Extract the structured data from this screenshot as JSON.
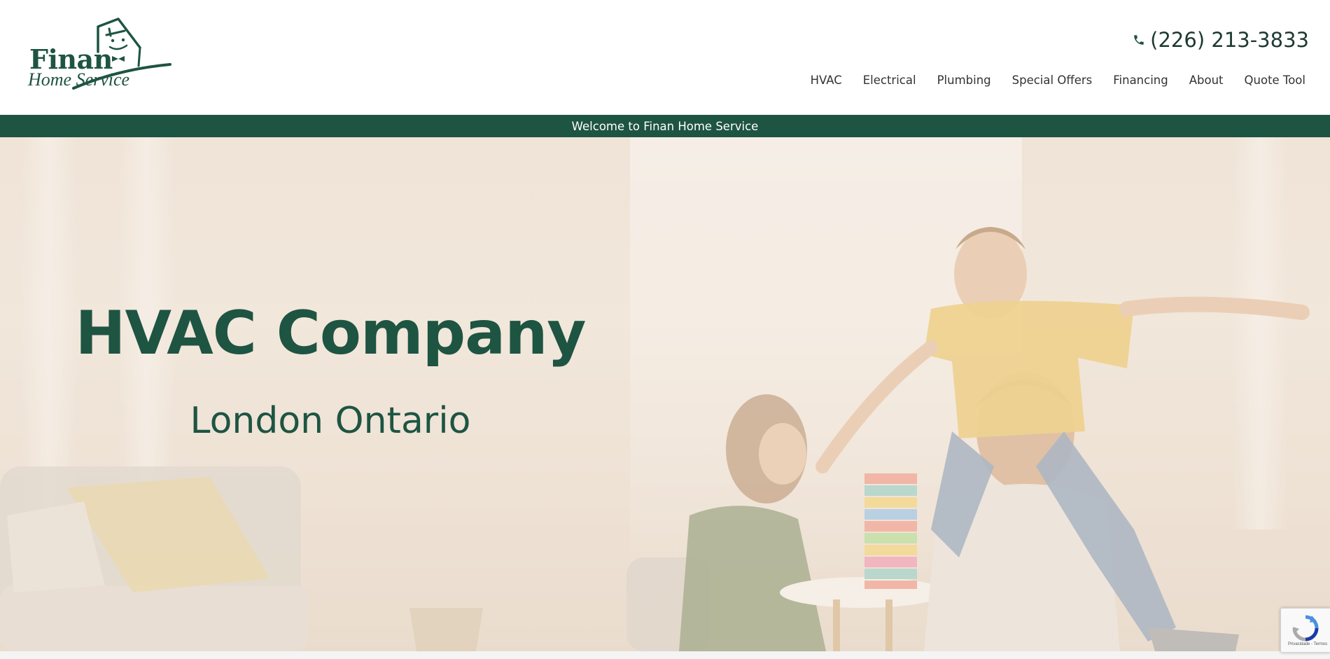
{
  "logo": {
    "brand": "Finan",
    "sub": "Home Service"
  },
  "phone": {
    "number": "(226) 213-3833",
    "icon": "phone-icon"
  },
  "nav": [
    "HVAC",
    "Electrical",
    "Plumbing",
    "Special Offers",
    "Financing",
    "About",
    "Quote Tool"
  ],
  "welcome_bar": {
    "text": "Welcome to Finan Home Service"
  },
  "hero": {
    "title": "HVAC Company",
    "subtitle": "London Ontario"
  },
  "recaptcha": {
    "text": "Privacidade - Termos"
  },
  "colors": {
    "brand_green": "#1e5442",
    "hero_bg": "#efe3d6",
    "text_dark": "#333333"
  }
}
